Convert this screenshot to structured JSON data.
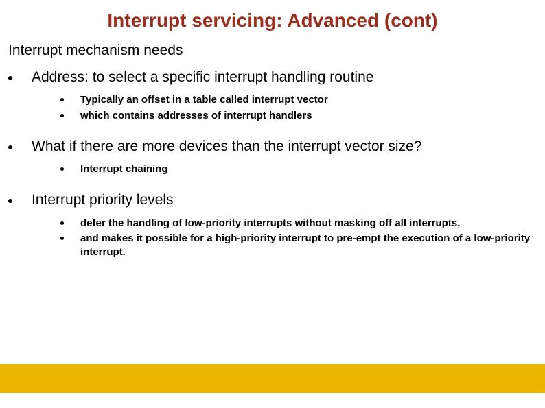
{
  "title": "Interrupt servicing: Advanced (cont)",
  "subtitle": "Interrupt mechanism needs",
  "items": [
    {
      "text": "Address: to select a specific interrupt handling routine",
      "subs": [
        "Typically an offset in a table called interrupt vector",
        "which contains addresses of interrupt handlers"
      ]
    },
    {
      "text": "What if there are more devices than the interrupt vector size?",
      "subs": [
        "Interrupt chaining"
      ]
    },
    {
      "text": "Interrupt priority levels",
      "subs": [
        "defer the handling of low-priority interrupts without masking off all interrupts,",
        "and makes it possible for a high-priority interrupt to pre-empt the execution of a low-priority interrupt."
      ]
    }
  ]
}
